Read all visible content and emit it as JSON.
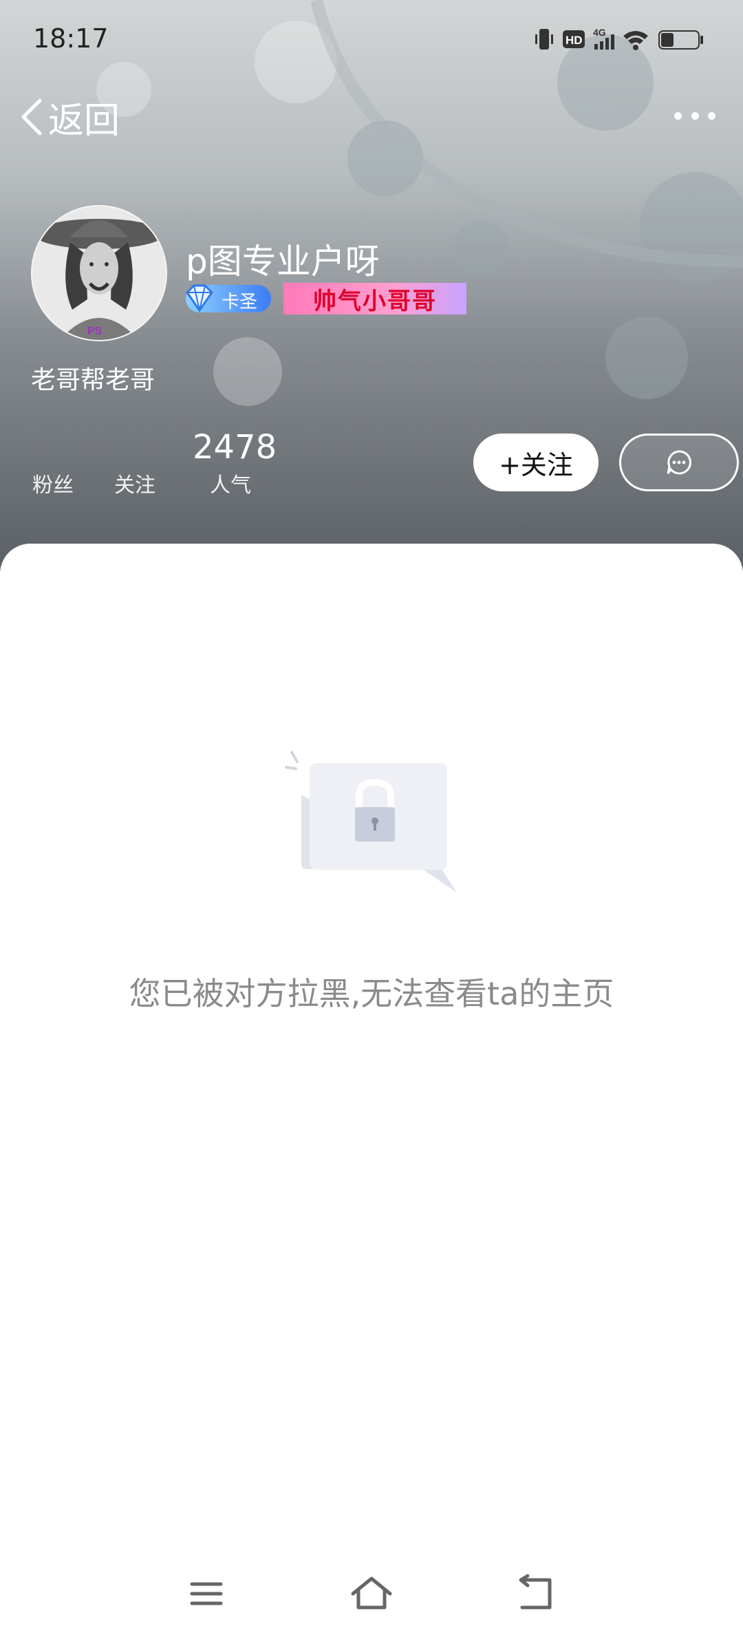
{
  "status_bar": {
    "time": "18:17",
    "network": "4G",
    "hd_label": "HD"
  },
  "nav": {
    "back_label": "返回"
  },
  "profile": {
    "username": "p图专业户呀",
    "level_badge": "卡圣",
    "title_badge": "帅气小哥哥",
    "bio": "老哥帮老哥",
    "avatar_caption": "PS",
    "stats": {
      "fans_label": "粉丝",
      "following_label": "关注",
      "popularity_value": "2478",
      "popularity_label": "人气"
    },
    "follow_button": "+关注"
  },
  "blocked": {
    "message": "您已被对方拉黑,无法查看ta的主页"
  },
  "colors": {
    "header_top": "#d3d5d6",
    "header_bottom": "#5b6065",
    "message_gray": "#8a8a8a"
  },
  "icons": {
    "back": "chevron-left-icon",
    "more": "more-dots-icon",
    "chat": "chat-bubble-icon",
    "lock": "lock-icon",
    "menu": "menu-icon",
    "home": "home-icon",
    "return": "return-icon"
  }
}
